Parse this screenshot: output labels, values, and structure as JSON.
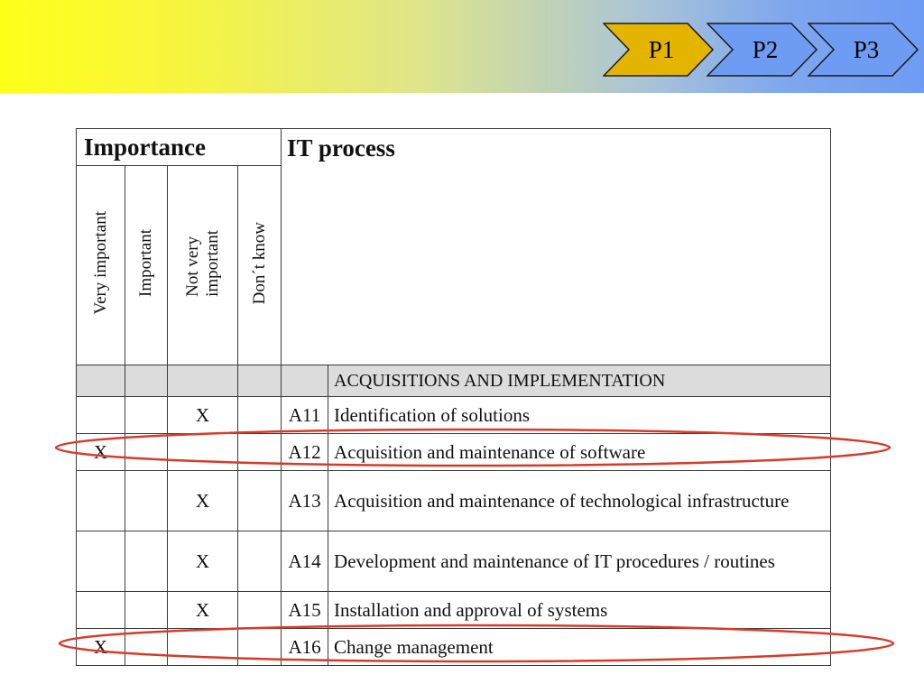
{
  "header": {
    "steps": [
      "P1",
      "P2",
      "P3"
    ],
    "active_step": "P1",
    "colors": {
      "active_fill": "#e3b400",
      "inactive_fill": "#6f9cf3",
      "gradient_left": "#ffff1a",
      "gradient_right": "#6e9bf4"
    }
  },
  "table": {
    "importance_header": "Importance",
    "process_header": "IT process",
    "importance_columns": [
      "Very important",
      "Important",
      "Not very\nimportant",
      "Don´t know"
    ],
    "section_title": "ACQUISITIONS AND IMPLEMENTATION",
    "rows": [
      {
        "code": "A11",
        "process": "Identification of solutions",
        "marks": [
          "",
          "",
          "X",
          ""
        ]
      },
      {
        "code": "A12",
        "process": "Acquisition and maintenance of software",
        "marks": [
          "X",
          "",
          "",
          ""
        ],
        "highlighted": true
      },
      {
        "code": "A13",
        "process": "Acquisition and maintenance of technological infrastructure",
        "marks": [
          "",
          "",
          "X",
          ""
        ]
      },
      {
        "code": "A14",
        "process": "Development and maintenance of IT procedures / routines",
        "marks": [
          "",
          "",
          "X",
          ""
        ]
      },
      {
        "code": "A15",
        "process": "Installation and approval of systems",
        "marks": [
          "",
          "",
          "X",
          ""
        ]
      },
      {
        "code": "A16",
        "process": "Change management",
        "marks": [
          "X",
          "",
          "",
          ""
        ],
        "highlighted": true
      }
    ],
    "highlight_color": "#d83a2a"
  }
}
